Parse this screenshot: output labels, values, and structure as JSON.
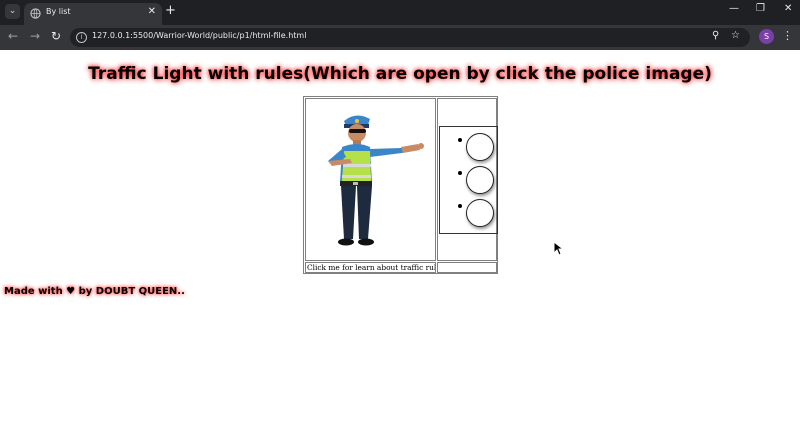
{
  "browser": {
    "tab_title": "By list",
    "tab_close": "✕",
    "new_tab": "+",
    "url": "127.0.0.1:5500/Warrior-World/public/p1/html-file.html",
    "profile_initial": "S",
    "icons": {
      "back": "back-arrow-icon",
      "forward": "forward-arrow-icon",
      "reload": "reload-icon",
      "zoom": "zoom-icon",
      "bookmark": "star-icon",
      "menu": "kebab-menu-icon"
    }
  },
  "page": {
    "title": "Traffic Light with rules(Which are open by click the police image)",
    "caption": "Click me for learn about traffic rules:)",
    "footer": "Made with ♥ by DOUBT QUEEN..",
    "title_glow_color": "#ff3333",
    "lights": [
      {
        "state": "off",
        "color": "#ffffff"
      },
      {
        "state": "off",
        "color": "#ffffff"
      },
      {
        "state": "off",
        "color": "#ffffff"
      }
    ]
  }
}
